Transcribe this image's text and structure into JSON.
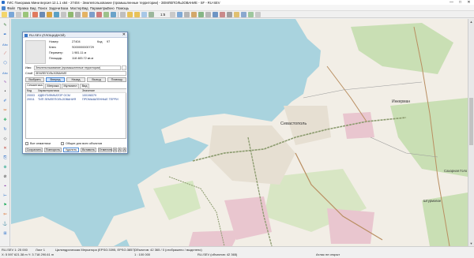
{
  "window": {
    "title": "ГИС Панорама Мини версия 12.1.1 x64 - 27404 - Землепользование (промышленные территории) - ЗЕМЛЕПОЛЬЗОВАНИЕ - SF - RU-SEV",
    "controls": [
      "—",
      "□",
      "✕"
    ]
  },
  "menu": {
    "items": [
      "Файл",
      "Правка",
      "Вид",
      "Поиск",
      "Задачи",
      "База",
      "Мастер",
      "Вид",
      "Параметры",
      "Окно",
      "Помощь"
    ]
  },
  "toolbar": {
    "scale_label": "1:5"
  },
  "left_tools": {
    "labels": [
      "Abc",
      "Abc"
    ]
  },
  "map": {
    "labels": {
      "city": "Севастополь",
      "inkerman": "Инкерман",
      "sakharnaya": "Сахарная Голо",
      "shturmovoe": "Штурмовое"
    },
    "colors": {
      "sea": "#a9d3de",
      "land": "#f2eee6",
      "green": "#c9dfb4",
      "industrial": "#e9c6cf",
      "road": "#8a9a6d"
    }
  },
  "dialog": {
    "title": "RU-SEV (ПЛОЩАДНОЙ)",
    "fields": {
      "number_label": "Номер",
      "number_value": "27404",
      "code_label": "Код",
      "code_value": "97",
      "key_label": "Ключ",
      "key_value": "S000000000729",
      "perimeter_label": "Периметр",
      "perimeter_value": "1 981.11 м",
      "area_label": "Площадь",
      "area_value": "118 483.72 кв.м",
      "name_label": "Имя",
      "name_value": "Землепользование (промышленные территории)",
      "layer_label": "Слой",
      "layer_value": "ЗЕМЛЕПОЛЬЗОВАНИЕ"
    },
    "buttons": [
      "Выбрать",
      "Вперед",
      "Назад",
      "Выход",
      "Помощь"
    ],
    "tabs": [
      "Семантика",
      "Метрика",
      "Мультипл",
      "Вид"
    ],
    "table": {
      "headers": [
        "Код",
        "Характеристика",
        "Значение"
      ],
      "rows": [
        [
          "20003",
          "ИДЕНТИФИКАТОР ОСМ",
          "100198379"
        ],
        [
          "20011",
          "ТИП ЗЕМЛЕПОЛЬЗОВАНИЯ",
          "ПРОМЫШЛЕННЫЕ ТЕРРИ"
        ]
      ]
    },
    "checkboxes": [
      "Все семантики",
      "Общие для всех объектов"
    ],
    "bottom_buttons": [
      "Сохранить",
      "Повторить",
      "Удалить",
      "Вставить",
      "Отменить"
    ],
    "font_buttons": [
      "A",
      "A",
      "A"
    ]
  },
  "status": {
    "scale": "RU-SEV 1: 25 000",
    "sheet": "Лист 1",
    "projection": "Цилиндрическая Меркатора (EPSG:3395, EPSG:3857)",
    "objects": "Объектов: 42 365 / 0 (отображено / выделено)",
    "coords": "X: 5 597 621.38 m   Y: 3 718 290.61 m",
    "ratio": "1 : 100 000",
    "layer_info": "RU-SEV (объектов: 42 365)",
    "atlas": "Атлас не открыт"
  }
}
